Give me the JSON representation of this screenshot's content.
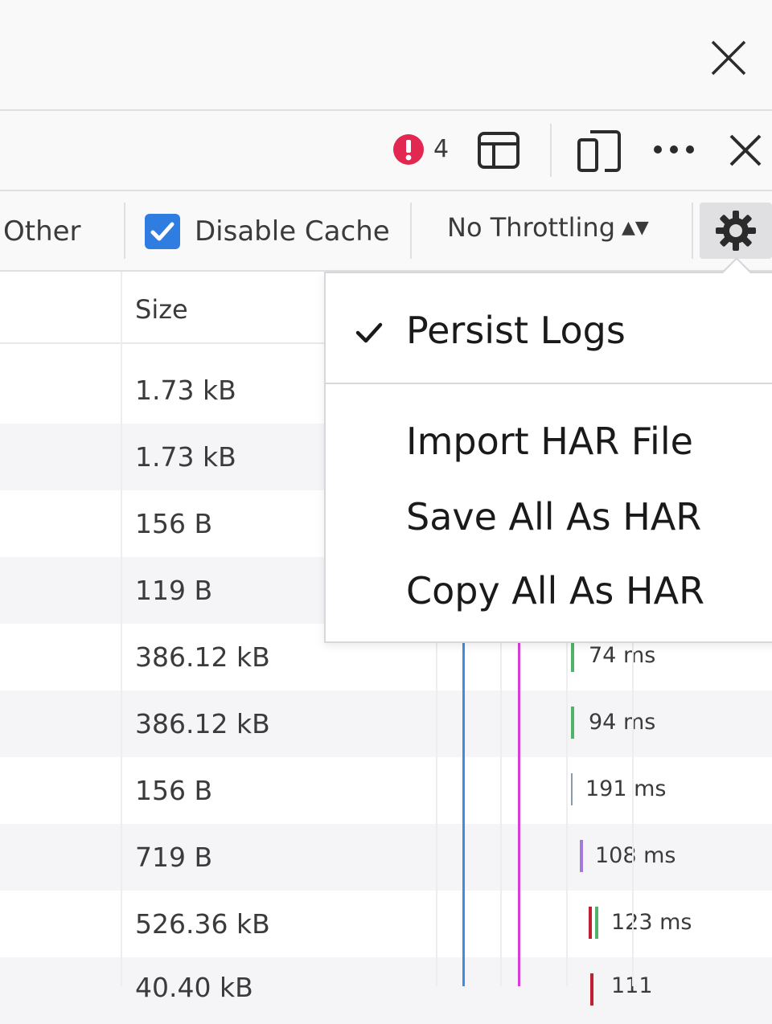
{
  "devtools_toolbar": {
    "error_count": "4"
  },
  "network_toolbar": {
    "filter_other": "Other",
    "disable_cache_label": "Disable Cache",
    "disable_cache_checked": true,
    "throttling_label": "No Throttling"
  },
  "table": {
    "header_size": "Size",
    "rows": [
      {
        "size": "1.73 kB",
        "time": ""
      },
      {
        "size": "1.73 kB",
        "time": ""
      },
      {
        "size": "156 B",
        "time": ""
      },
      {
        "size": "119 B",
        "time": ""
      },
      {
        "size": "386.12 kB",
        "time": "74 ms"
      },
      {
        "size": "386.12 kB",
        "time": "94 ms"
      },
      {
        "size": "156 B",
        "time": "191 ms"
      },
      {
        "size": "719 B",
        "time": "108 ms"
      },
      {
        "size": "526.36 kB",
        "time": "123 ms"
      },
      {
        "size": "40.40 kB",
        "time": "111"
      }
    ]
  },
  "settings_menu": {
    "items": [
      {
        "label": "Persist Logs",
        "checked": true
      },
      {
        "label": "Import HAR File",
        "checked": false
      },
      {
        "label": "Save All As HAR",
        "checked": false
      },
      {
        "label": "Copy All As HAR",
        "checked": false
      }
    ]
  },
  "colors": {
    "accent_blue": "#2f7de1",
    "error_red": "#e22850",
    "timeline_blue": "#3f8ce0",
    "timeline_magenta": "#d63fd6",
    "timing_green": "#4fb36b",
    "timing_purple": "#a37ad9",
    "timing_red": "#c22030"
  }
}
